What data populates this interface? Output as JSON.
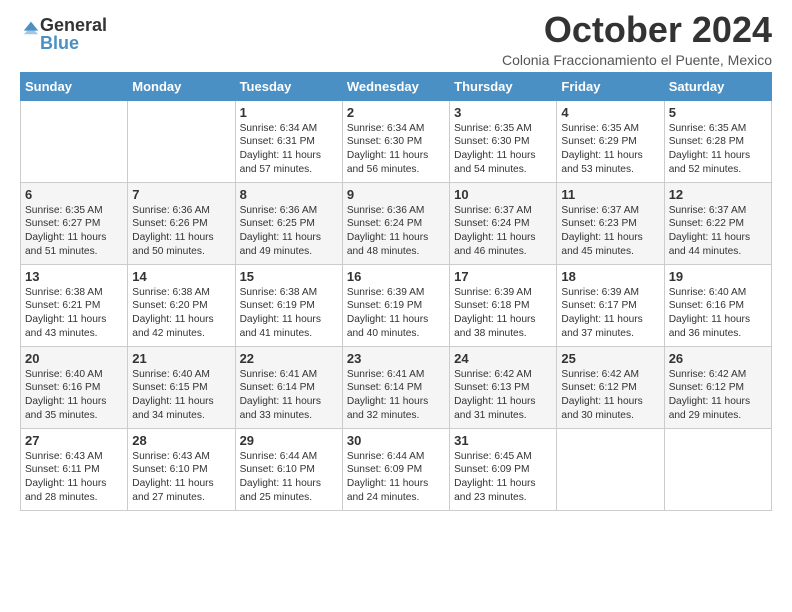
{
  "logo": {
    "general": "General",
    "blue": "Blue"
  },
  "header": {
    "month_title": "October 2024",
    "subtitle": "Colonia Fraccionamiento el Puente, Mexico"
  },
  "weekdays": [
    "Sunday",
    "Monday",
    "Tuesday",
    "Wednesday",
    "Thursday",
    "Friday",
    "Saturday"
  ],
  "weeks": [
    [
      {
        "day": "",
        "content": ""
      },
      {
        "day": "",
        "content": ""
      },
      {
        "day": "1",
        "content": "Sunrise: 6:34 AM\nSunset: 6:31 PM\nDaylight: 11 hours and 57 minutes."
      },
      {
        "day": "2",
        "content": "Sunrise: 6:34 AM\nSunset: 6:30 PM\nDaylight: 11 hours and 56 minutes."
      },
      {
        "day": "3",
        "content": "Sunrise: 6:35 AM\nSunset: 6:30 PM\nDaylight: 11 hours and 54 minutes."
      },
      {
        "day": "4",
        "content": "Sunrise: 6:35 AM\nSunset: 6:29 PM\nDaylight: 11 hours and 53 minutes."
      },
      {
        "day": "5",
        "content": "Sunrise: 6:35 AM\nSunset: 6:28 PM\nDaylight: 11 hours and 52 minutes."
      }
    ],
    [
      {
        "day": "6",
        "content": "Sunrise: 6:35 AM\nSunset: 6:27 PM\nDaylight: 11 hours and 51 minutes."
      },
      {
        "day": "7",
        "content": "Sunrise: 6:36 AM\nSunset: 6:26 PM\nDaylight: 11 hours and 50 minutes."
      },
      {
        "day": "8",
        "content": "Sunrise: 6:36 AM\nSunset: 6:25 PM\nDaylight: 11 hours and 49 minutes."
      },
      {
        "day": "9",
        "content": "Sunrise: 6:36 AM\nSunset: 6:24 PM\nDaylight: 11 hours and 48 minutes."
      },
      {
        "day": "10",
        "content": "Sunrise: 6:37 AM\nSunset: 6:24 PM\nDaylight: 11 hours and 46 minutes."
      },
      {
        "day": "11",
        "content": "Sunrise: 6:37 AM\nSunset: 6:23 PM\nDaylight: 11 hours and 45 minutes."
      },
      {
        "day": "12",
        "content": "Sunrise: 6:37 AM\nSunset: 6:22 PM\nDaylight: 11 hours and 44 minutes."
      }
    ],
    [
      {
        "day": "13",
        "content": "Sunrise: 6:38 AM\nSunset: 6:21 PM\nDaylight: 11 hours and 43 minutes."
      },
      {
        "day": "14",
        "content": "Sunrise: 6:38 AM\nSunset: 6:20 PM\nDaylight: 11 hours and 42 minutes."
      },
      {
        "day": "15",
        "content": "Sunrise: 6:38 AM\nSunset: 6:19 PM\nDaylight: 11 hours and 41 minutes."
      },
      {
        "day": "16",
        "content": "Sunrise: 6:39 AM\nSunset: 6:19 PM\nDaylight: 11 hours and 40 minutes."
      },
      {
        "day": "17",
        "content": "Sunrise: 6:39 AM\nSunset: 6:18 PM\nDaylight: 11 hours and 38 minutes."
      },
      {
        "day": "18",
        "content": "Sunrise: 6:39 AM\nSunset: 6:17 PM\nDaylight: 11 hours and 37 minutes."
      },
      {
        "day": "19",
        "content": "Sunrise: 6:40 AM\nSunset: 6:16 PM\nDaylight: 11 hours and 36 minutes."
      }
    ],
    [
      {
        "day": "20",
        "content": "Sunrise: 6:40 AM\nSunset: 6:16 PM\nDaylight: 11 hours and 35 minutes."
      },
      {
        "day": "21",
        "content": "Sunrise: 6:40 AM\nSunset: 6:15 PM\nDaylight: 11 hours and 34 minutes."
      },
      {
        "day": "22",
        "content": "Sunrise: 6:41 AM\nSunset: 6:14 PM\nDaylight: 11 hours and 33 minutes."
      },
      {
        "day": "23",
        "content": "Sunrise: 6:41 AM\nSunset: 6:14 PM\nDaylight: 11 hours and 32 minutes."
      },
      {
        "day": "24",
        "content": "Sunrise: 6:42 AM\nSunset: 6:13 PM\nDaylight: 11 hours and 31 minutes."
      },
      {
        "day": "25",
        "content": "Sunrise: 6:42 AM\nSunset: 6:12 PM\nDaylight: 11 hours and 30 minutes."
      },
      {
        "day": "26",
        "content": "Sunrise: 6:42 AM\nSunset: 6:12 PM\nDaylight: 11 hours and 29 minutes."
      }
    ],
    [
      {
        "day": "27",
        "content": "Sunrise: 6:43 AM\nSunset: 6:11 PM\nDaylight: 11 hours and 28 minutes."
      },
      {
        "day": "28",
        "content": "Sunrise: 6:43 AM\nSunset: 6:10 PM\nDaylight: 11 hours and 27 minutes."
      },
      {
        "day": "29",
        "content": "Sunrise: 6:44 AM\nSunset: 6:10 PM\nDaylight: 11 hours and 25 minutes."
      },
      {
        "day": "30",
        "content": "Sunrise: 6:44 AM\nSunset: 6:09 PM\nDaylight: 11 hours and 24 minutes."
      },
      {
        "day": "31",
        "content": "Sunrise: 6:45 AM\nSunset: 6:09 PM\nDaylight: 11 hours and 23 minutes."
      },
      {
        "day": "",
        "content": ""
      },
      {
        "day": "",
        "content": ""
      }
    ]
  ]
}
